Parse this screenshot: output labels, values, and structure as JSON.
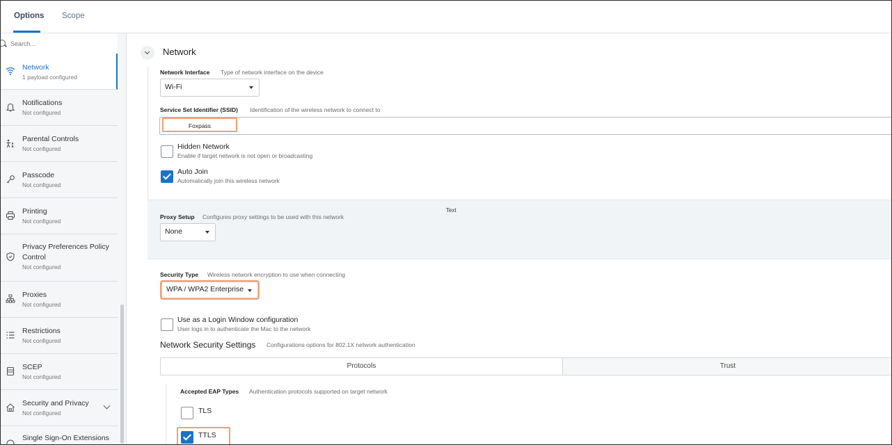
{
  "tabs": {
    "options": "Options",
    "scope": "Scope"
  },
  "sidebar": {
    "search_placeholder": "Search...",
    "items": [
      {
        "title": "Network",
        "sub": "1 payload configured",
        "icon": "wifi-icon"
      },
      {
        "title": "Notifications",
        "sub": "Not configured",
        "icon": "bell-icon"
      },
      {
        "title": "Parental Controls",
        "sub": "Not configured",
        "icon": "parental-icon"
      },
      {
        "title": "Passcode",
        "sub": "Not configured",
        "icon": "key-icon"
      },
      {
        "title": "Printing",
        "sub": "Not configured",
        "icon": "printer-icon"
      },
      {
        "title": "Privacy Preferences Policy Control",
        "sub": "Not configured",
        "icon": "shield-icon"
      },
      {
        "title": "Proxies",
        "sub": "Not configured",
        "icon": "network-tree-icon"
      },
      {
        "title": "Restrictions",
        "sub": "Not configured",
        "icon": "list-icon"
      },
      {
        "title": "SCEP",
        "sub": "Not configured",
        "icon": "document-icon"
      },
      {
        "title": "Security and Privacy",
        "sub": "Not configured",
        "icon": "house-lock-icon"
      },
      {
        "title": "Single Sign-On Extensions",
        "sub": "",
        "icon": "sso-icon"
      }
    ]
  },
  "main": {
    "section_title": "Network",
    "network_interface": {
      "label": "Network Interface",
      "desc": "Type of network interface on the device",
      "value": "Wi-Fi"
    },
    "ssid": {
      "label": "Service Set Identifier (SSID)",
      "desc": "Identification of the wireless network to connect to",
      "value": "Foxpass"
    },
    "hidden_network": {
      "label": "Hidden Network",
      "desc": "Enable if target network is not open or broadcasting",
      "checked": false
    },
    "auto_join": {
      "label": "Auto Join",
      "desc": "Automatically join this wireless network",
      "checked": true
    },
    "floating_text": "Text",
    "proxy": {
      "label": "Proxy Setup",
      "desc": "Configures proxy settings to be used with this network",
      "value": "None"
    },
    "security_type": {
      "label": "Security Type",
      "desc": "Wireless network encryption to use when connecting",
      "value": "WPA / WPA2 Enterprise"
    },
    "login_window": {
      "label": "Use as a Login Window configuration",
      "desc": "User logs in to authenticate the Mac to the network",
      "checked": false
    },
    "net_security": {
      "title": "Network Security Settings",
      "desc": "Configurations options for 802.1X network authentication"
    },
    "sec_tabs": {
      "protocols": "Protocols",
      "trust": "Trust"
    },
    "eap": {
      "label": "Accepted EAP Types",
      "desc": "Authentication protocols supported on target network"
    },
    "tls": {
      "label": "TLS",
      "checked": false
    },
    "ttls": {
      "label": "TTLS",
      "checked": true
    }
  },
  "colors": {
    "accent": "#1a73c8",
    "highlight": "#f0a070",
    "sidebar_bg": "#f4f6f8"
  }
}
